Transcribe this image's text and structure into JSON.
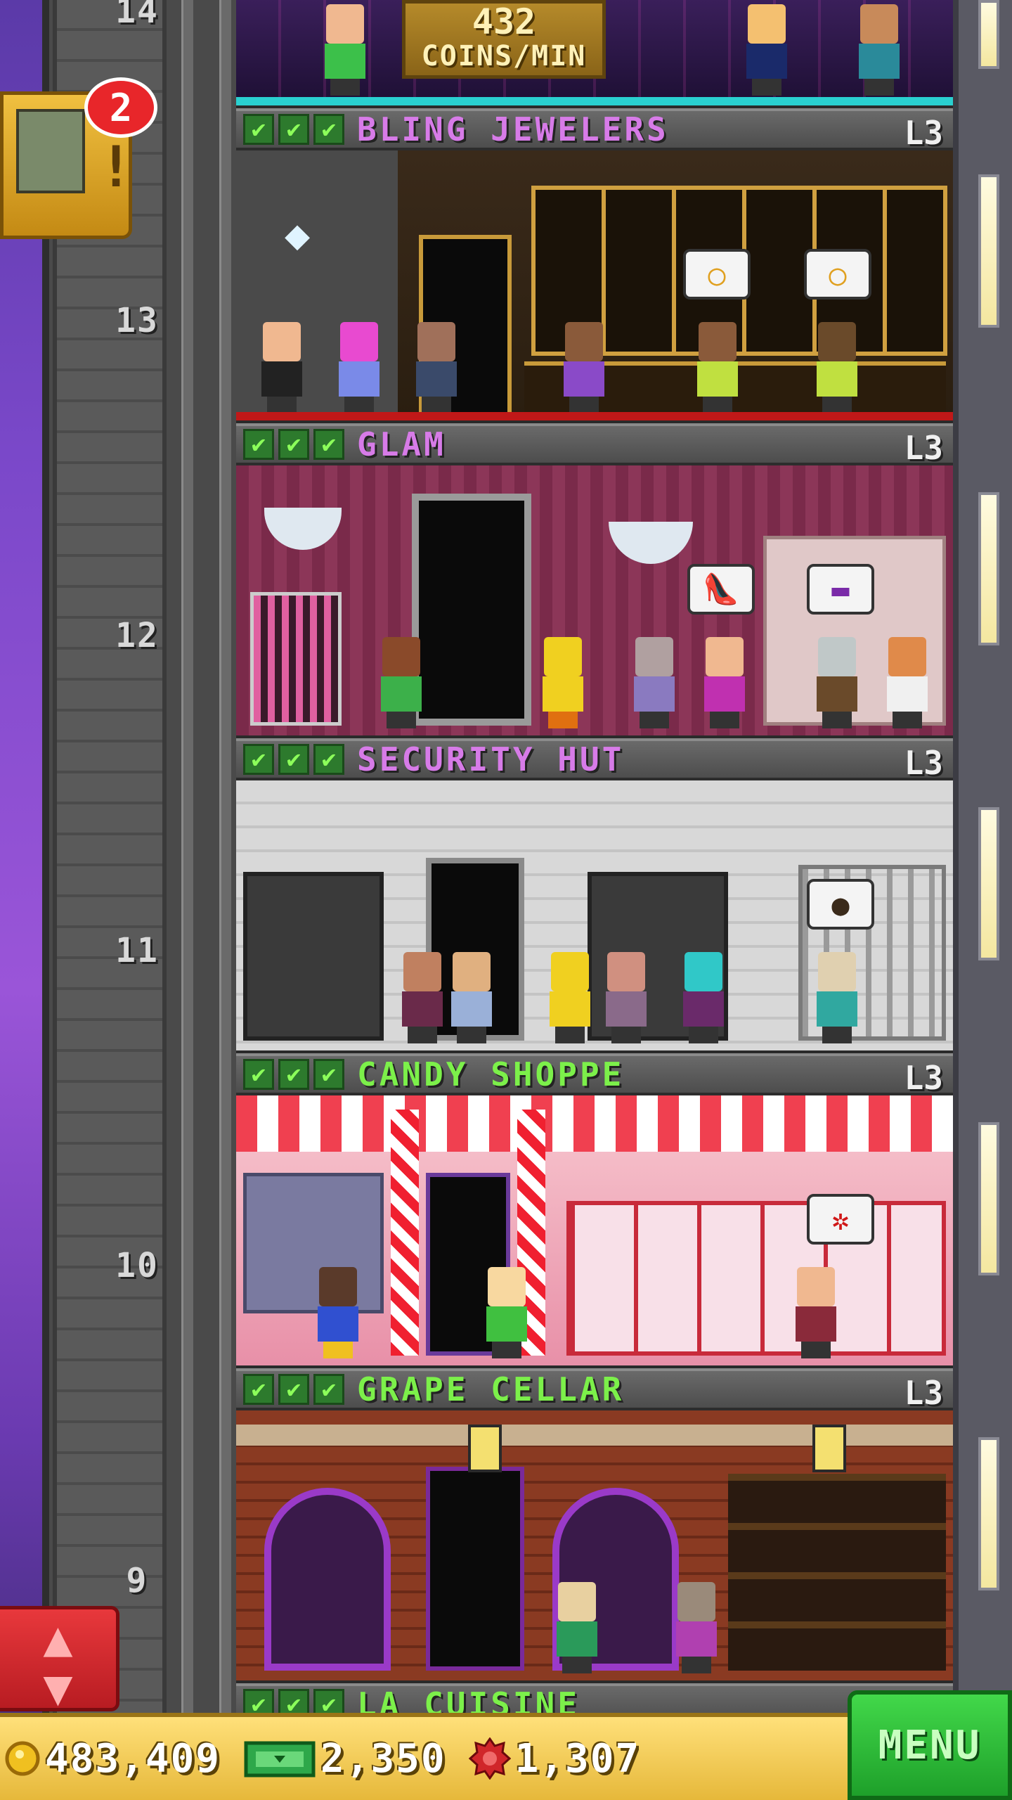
{
  "top_floor": {
    "number": "14",
    "coins_value": "432",
    "coins_label": "COINS/MIN"
  },
  "notification": {
    "count": "2"
  },
  "floors": [
    {
      "name": "BLING JEWELERS",
      "level": "L3",
      "number": "13",
      "name_color": "#d77be8"
    },
    {
      "name": "GLAM",
      "level": "L3",
      "number": "12",
      "name_color": "#d77be8"
    },
    {
      "name": "SECURITY HUT",
      "level": "L3",
      "number": "11",
      "name_color": "#d77be8"
    },
    {
      "name": "CANDY SHOPPE",
      "level": "L3",
      "number": "10",
      "name_color": "#7cf04a"
    },
    {
      "name": "GRAPE CELLAR",
      "level": "L3",
      "number": "9",
      "name_color": "#7cf04a"
    },
    {
      "name": "LA CUISINE",
      "name_color": "#7cf04a"
    }
  ],
  "bottom_bar": {
    "coins": "483,409",
    "bux": "2,350",
    "tokens": "1,307"
  },
  "menu_label": "MENU",
  "colors": {
    "coin": "#f0c020",
    "bux": "#2ea84a",
    "token": "#d0262a",
    "menu_green": "#2ec03a"
  },
  "icons": {
    "check": "check-icon",
    "coin": "coin-icon",
    "bux": "bux-icon",
    "token": "token-icon",
    "elevator": "elevator-arrows-icon"
  }
}
